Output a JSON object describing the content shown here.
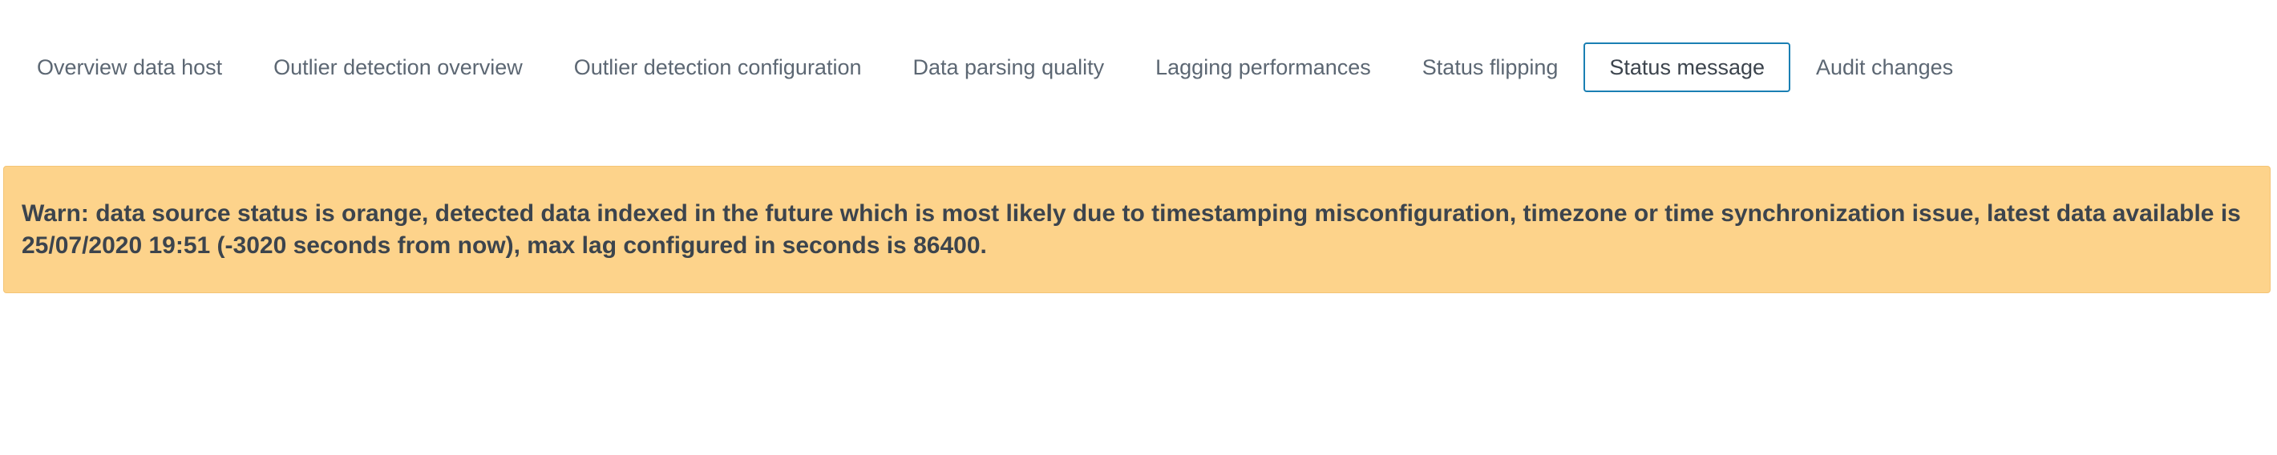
{
  "tabs": [
    {
      "label": "Overview data host",
      "active": false
    },
    {
      "label": "Outlier detection overview",
      "active": false
    },
    {
      "label": "Outlier detection configuration",
      "active": false
    },
    {
      "label": "Data parsing quality",
      "active": false
    },
    {
      "label": "Lagging performances",
      "active": false
    },
    {
      "label": "Status flipping",
      "active": false
    },
    {
      "label": "Status message",
      "active": true
    },
    {
      "label": "Audit changes",
      "active": false
    }
  ],
  "alert": {
    "message": "Warn: data source status is orange, detected data indexed in the future which is most likely due to timestamping misconfiguration, timezone or time synchronization issue, latest data available is 25/07/2020 19:51 (-3020 seconds from now), max lag configured in seconds is 86400.",
    "background_color": "#fdd38b"
  },
  "colors": {
    "active_tab_border": "#1a7fb3",
    "text": "#3c444d",
    "tab_text": "#5c6773"
  }
}
